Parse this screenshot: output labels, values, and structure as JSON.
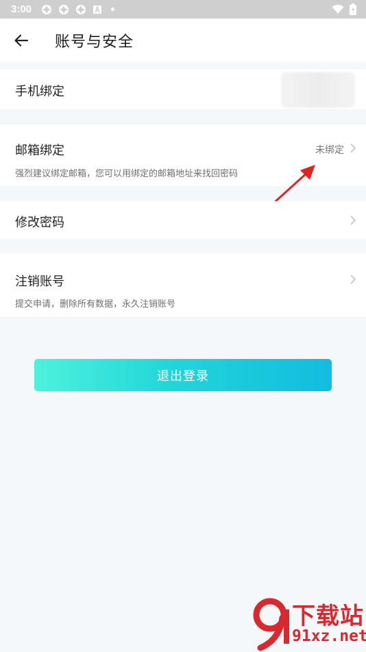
{
  "status_bar": {
    "time": "3:00"
  },
  "header": {
    "title": "账号与安全"
  },
  "rows": {
    "phone": {
      "title": "手机绑定"
    },
    "email": {
      "title": "邮箱绑定",
      "value": "未绑定",
      "subtitle": "强烈建议绑定邮箱，您可以用绑定的邮箱地址来找回密码"
    },
    "password": {
      "title": "修改密码"
    },
    "cancel_account": {
      "title": "注销账号",
      "subtitle": "提交申请，删除所有数据，永久注销账号"
    }
  },
  "logout": {
    "label": "退出登录"
  },
  "watermark": {
    "name": "下载站",
    "url": "91xz.net"
  },
  "colors": {
    "accent_start": "#4df2dc",
    "accent_end": "#12bce0",
    "watermark_red": "#d8292f",
    "page_bg": "#f4f8fb"
  }
}
